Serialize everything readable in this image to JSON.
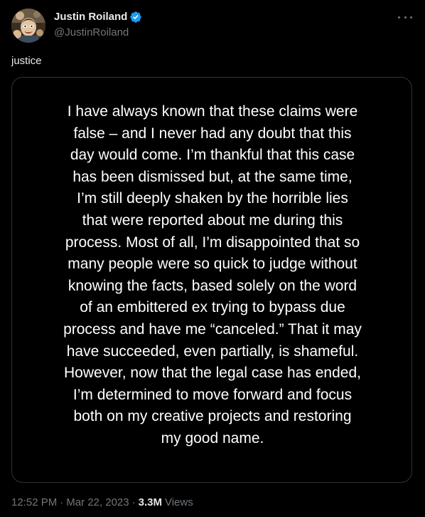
{
  "author": {
    "name": "Justin Roiland",
    "handle": "@JustinRoiland",
    "verified": true
  },
  "tweet": {
    "text": "justice"
  },
  "media": {
    "statement": "I have always known that these claims were\nfalse – and I never had any doubt that this\nday would come. I’m thankful that this case\nhas been dismissed but, at the same time,\nI’m still deeply shaken by the horrible lies\nthat were reported about me during this\nprocess. Most of all, I’m disappointed that so\nmany people were so quick to judge without\nknowing the facts, based solely on the word\nof an embittered ex trying to bypass due\nprocess and have me “canceled.” That it may\nhave succeeded, even partially, is shameful.\nHowever, now that the legal case has ended,\nI’m determined to move forward and focus\nboth on my creative projects and restoring\nmy good name."
  },
  "meta": {
    "time": "12:52 PM",
    "separator": "·",
    "date": "Mar 22, 2023",
    "views_count": "3.3M",
    "views_label": "Views"
  },
  "icons": {
    "verified": "verified-badge-icon",
    "more": "more-options-icon"
  },
  "colors": {
    "background": "#000000",
    "primary_text": "#e7e9ea",
    "secondary_text": "#71767b",
    "verified_blue": "#1d9bf0",
    "border": "#2f3336"
  }
}
